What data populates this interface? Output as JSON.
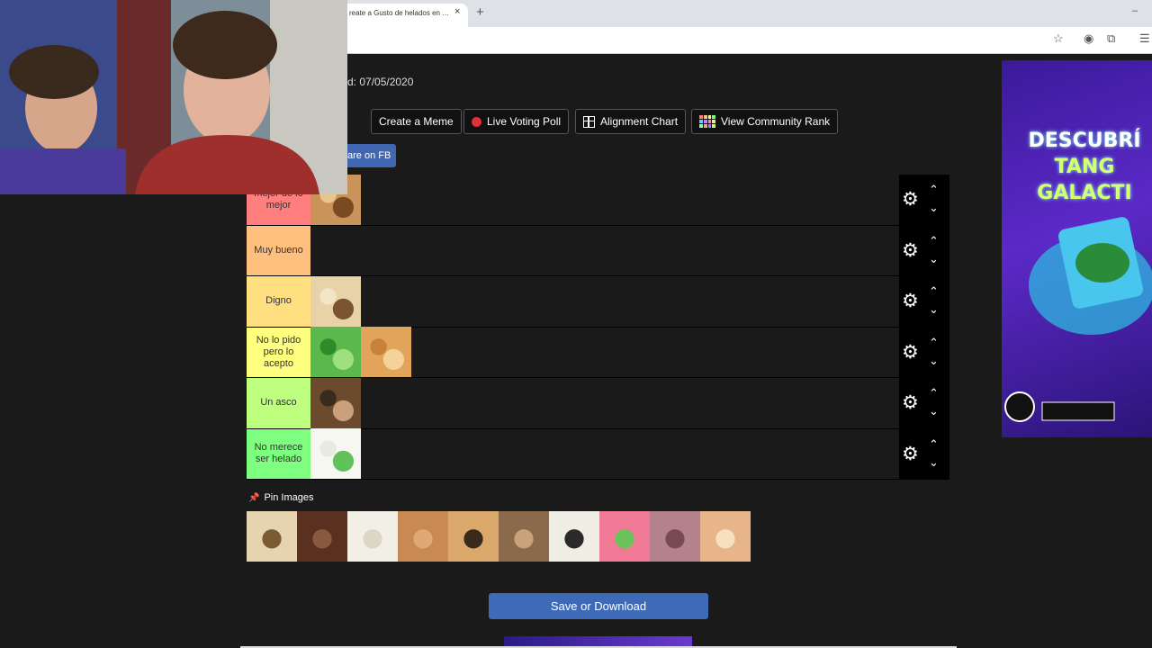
{
  "browser": {
    "tab_title": "reate a Gusto de helados en …",
    "tab_close": "×",
    "new_tab": "+",
    "minimize": "–"
  },
  "header": {
    "added_text": "d: 07/05/2020",
    "share_fb": "are on FB"
  },
  "toolbar": {
    "create_meme": "Create a Meme",
    "live_voting": "Live Voting Poll",
    "alignment_chart": "Alignment Chart",
    "community_rank": "View Community Rank"
  },
  "tiers": [
    {
      "label": "mejor de lo mejor",
      "color": "#ff7f7f",
      "items": 1
    },
    {
      "label": "Muy bueno",
      "color": "#ffbf7f",
      "items": 0
    },
    {
      "label": "Digno",
      "color": "#ffdf7f",
      "items": 1
    },
    {
      "label": "No lo pido pero lo acepto",
      "color": "#ffff7f",
      "items": 2
    },
    {
      "label": "Un asco",
      "color": "#bfff7f",
      "items": 1
    },
    {
      "label": "No merece ser helado",
      "color": "#7fff7f",
      "items": 1
    }
  ],
  "icons": {
    "gear": "⚙",
    "up": "⌃",
    "down": "⌄",
    "pin": "📌"
  },
  "pin_images": "Pin Images",
  "pool_count": 10,
  "save": "Save or Download",
  "ad": {
    "line1": "DESCUBRÍ",
    "line2": "TANG GALACTI"
  }
}
